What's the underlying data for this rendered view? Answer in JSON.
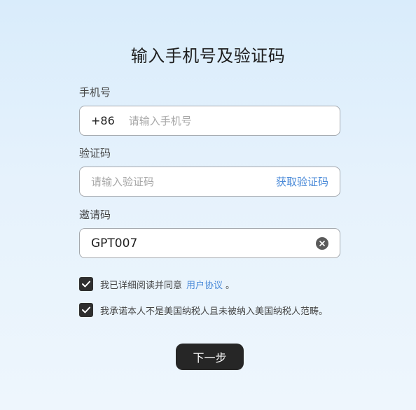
{
  "page": {
    "title": "输入手机号及验证码"
  },
  "phone": {
    "label": "手机号",
    "country_code": "+86",
    "placeholder": "请输入手机号",
    "value": ""
  },
  "code": {
    "label": "验证码",
    "placeholder": "请输入验证码",
    "value": "",
    "get_code_label": "获取验证码"
  },
  "invite": {
    "label": "邀请码",
    "value": "GPT007",
    "clear_icon": "clear-icon"
  },
  "agreements": {
    "terms_prefix": "我已详细阅读并同意",
    "terms_link": "用户协议",
    "terms_suffix": "。",
    "terms_checked": true,
    "tax_text": "我承诺本人不是美国纳税人且未被纳入美国纳税人范畴。",
    "tax_checked": true
  },
  "actions": {
    "next_label": "下一步"
  },
  "colors": {
    "accent_link": "#4a8ad8",
    "button_bg": "#262626",
    "checkbox_bg": "#2f2f2f"
  }
}
